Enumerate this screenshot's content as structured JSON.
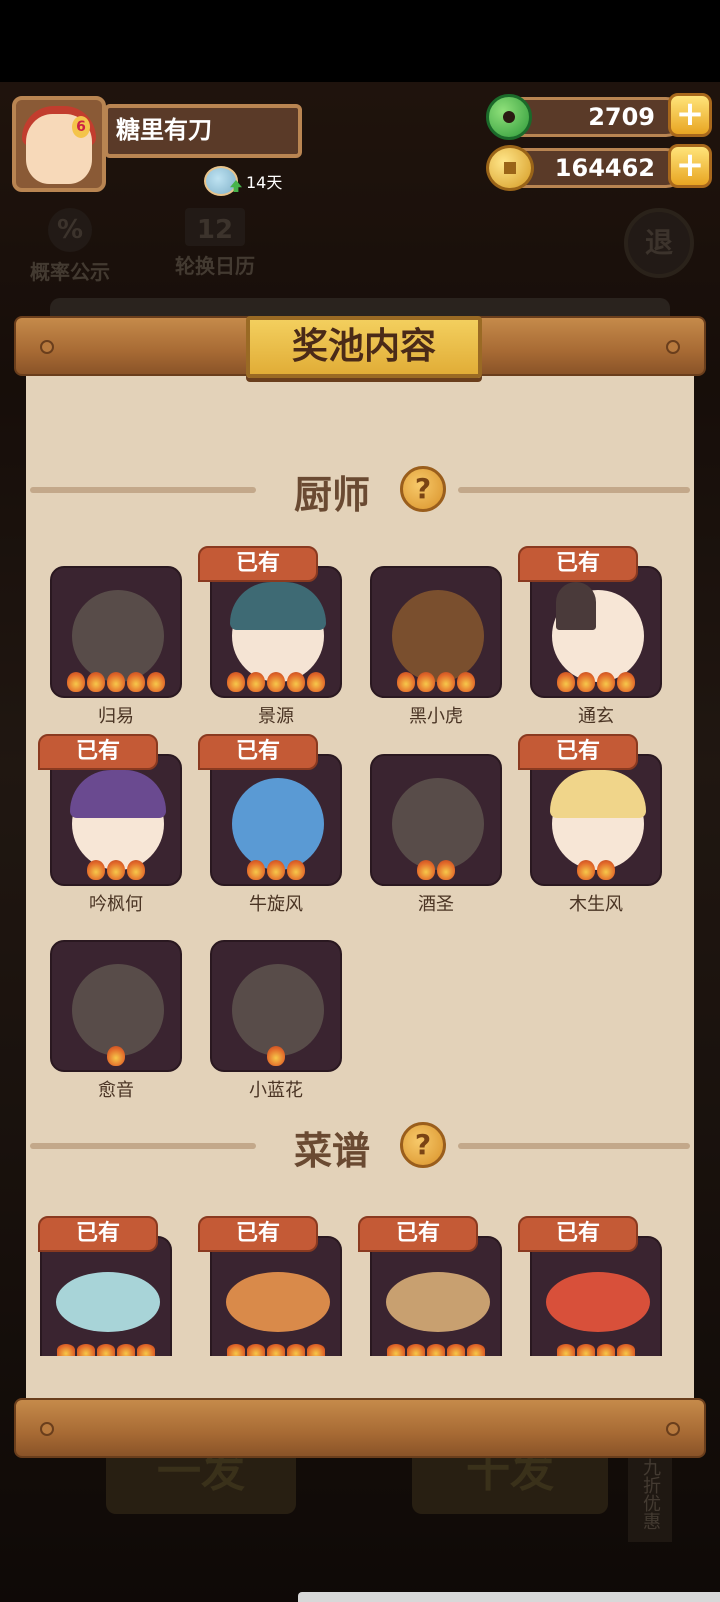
{
  "player": {
    "name": "糖里有刀",
    "days": "14天",
    "avatar_badge": "6"
  },
  "currency": {
    "jade": "2709",
    "coins": "164462",
    "plus": "+"
  },
  "bg_buttons": {
    "probability": "概率公示",
    "probability_icon": "%",
    "calendar": "轮换日历",
    "calendar_icon": "12",
    "exit": "退",
    "single": "一发",
    "ten": "十发",
    "discount": "九折优惠"
  },
  "panel": {
    "title": "奖池内容"
  },
  "chef_section": {
    "title": "厨师",
    "help": "?"
  },
  "chefs": [
    {
      "name": "归易",
      "owned": false,
      "stars": 5
    },
    {
      "name": "景源",
      "owned": true,
      "stars": 5
    },
    {
      "name": "黑小虎",
      "owned": false,
      "stars": 4
    },
    {
      "name": "通玄",
      "owned": true,
      "stars": 4
    },
    {
      "name": "吟枫何",
      "owned": true,
      "stars": 3
    },
    {
      "name": "牛旋风",
      "owned": true,
      "stars": 3
    },
    {
      "name": "酒圣",
      "owned": false,
      "stars": 2
    },
    {
      "name": "木生风",
      "owned": true,
      "stars": 2
    },
    {
      "name": "愈音",
      "owned": false,
      "stars": 1
    },
    {
      "name": "小蓝花",
      "owned": false,
      "stars": 1
    }
  ],
  "owned_label": "已有",
  "recipe_section": {
    "title": "菜谱",
    "help": "?"
  },
  "recipes": [
    {
      "owned": true,
      "stars": 5
    },
    {
      "owned": true,
      "stars": 5
    },
    {
      "owned": true,
      "stars": 5
    },
    {
      "owned": true,
      "stars": 4
    }
  ]
}
